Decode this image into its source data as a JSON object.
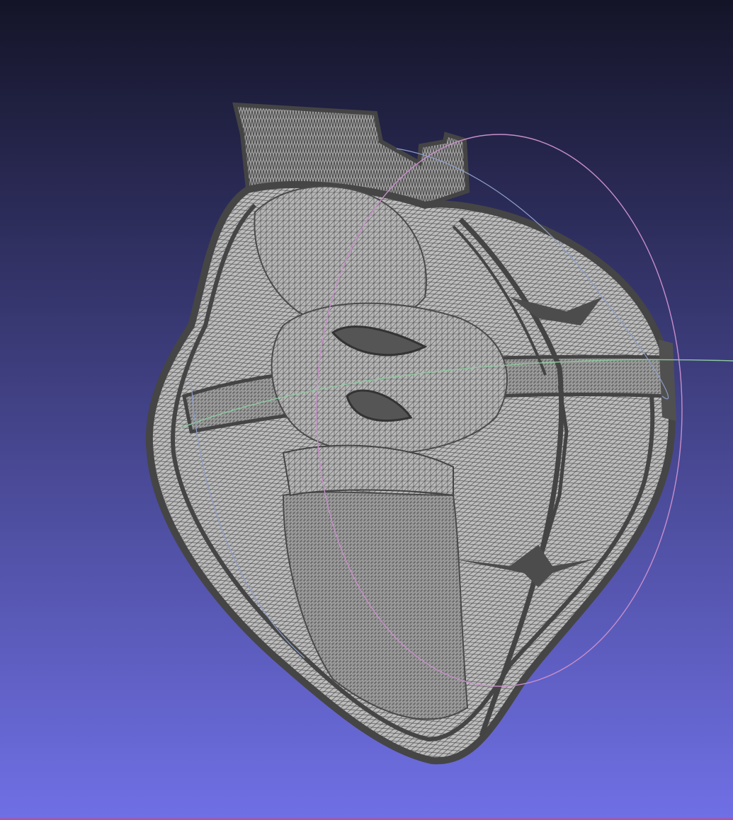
{
  "viewport": {
    "background_top": "#141428",
    "background_bottom": "#7070e6",
    "mesh_fill": "#b4b4b4",
    "mesh_edge": "#454545",
    "border_color": "#9a5ab4"
  },
  "trackball": {
    "ring_x_color": "#c78ec9",
    "ring_y_color": "#8ec9a0",
    "ring_z_color": "#8e9ec9"
  },
  "model": {
    "description_icon": "heart-mesh-wireframe"
  }
}
